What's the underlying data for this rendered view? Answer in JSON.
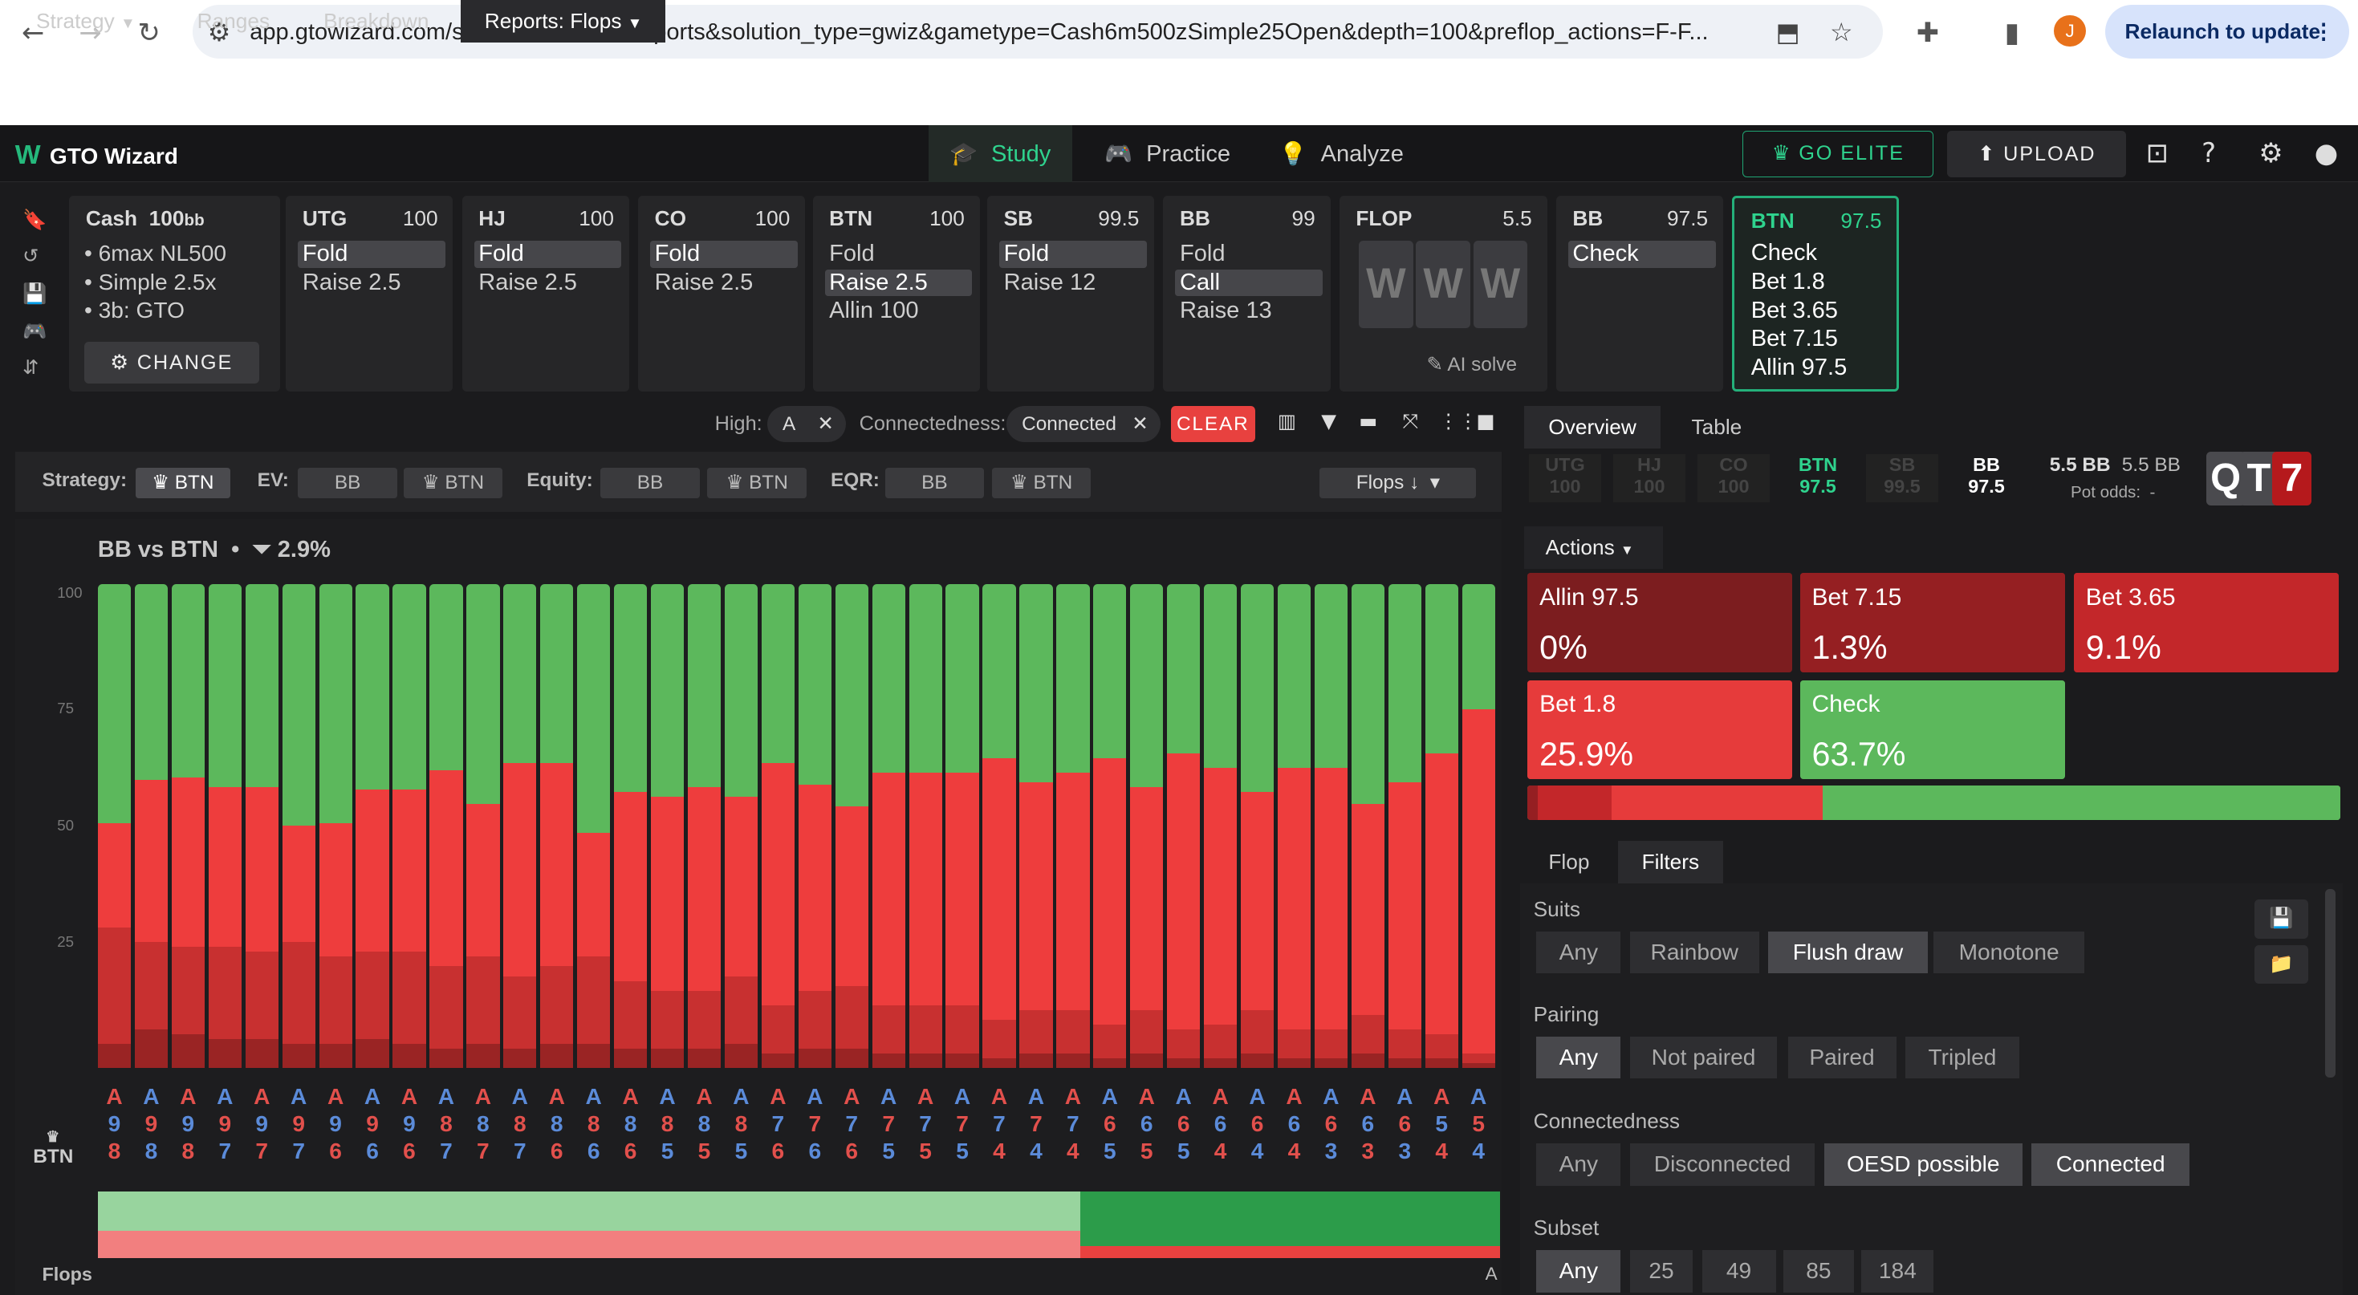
{
  "browser": {
    "url": "app.gtowizard.com/solutions?soltab=reports&solution_type=gwiz&gametype=Cash6m500zSimple25Open&depth=100&preflop_actions=F-F...",
    "relaunch": "Relaunch to update",
    "avatar": "J"
  },
  "app": {
    "logo": "GTO Wizard",
    "nav": [
      "Study",
      "Practice",
      "Analyze"
    ],
    "go_elite": "GO ELITE",
    "upload": "UPLOAD"
  },
  "game": {
    "title": "Cash",
    "stack": "100",
    "stack_unit": "bb",
    "bullets": [
      "6max NL500",
      "Simple 2.5x",
      "3b: GTO"
    ],
    "change": "CHANGE"
  },
  "positions": [
    {
      "name": "UTG",
      "stack": "100",
      "actions": [
        "Fold",
        "Raise 2.5"
      ],
      "sel": 0
    },
    {
      "name": "HJ",
      "stack": "100",
      "actions": [
        "Fold",
        "Raise 2.5"
      ],
      "sel": 0
    },
    {
      "name": "CO",
      "stack": "100",
      "actions": [
        "Fold",
        "Raise 2.5"
      ],
      "sel": 0
    },
    {
      "name": "BTN",
      "stack": "100",
      "actions": [
        "Fold",
        "Raise 2.5",
        "Allin 100"
      ],
      "sel": 1
    },
    {
      "name": "SB",
      "stack": "99.5",
      "actions": [
        "Fold",
        "Raise 12"
      ],
      "sel": 0
    },
    {
      "name": "BB",
      "stack": "99",
      "actions": [
        "Fold",
        "Call",
        "Raise 13"
      ],
      "sel": 1
    }
  ],
  "flop": {
    "label": "FLOP",
    "pot": "5.5",
    "cards": [
      "W",
      "W",
      "W"
    ],
    "ai": "AI solve"
  },
  "bb_card": {
    "name": "BB",
    "stack": "97.5",
    "actions": [
      "Check"
    ]
  },
  "btn_card": {
    "name": "BTN",
    "stack": "97.5",
    "actions": [
      "Check",
      "Bet 1.8",
      "Bet 3.65",
      "Bet 7.15",
      "Allin 97.5"
    ]
  },
  "tabs": {
    "strategy": "Strategy",
    "ranges": "Ranges",
    "breakdown": "Breakdown",
    "reports": "Reports: Flops"
  },
  "filters": {
    "high_label": "High:",
    "high_val": "A",
    "conn_label": "Connectedness:",
    "conn_val": "Connected",
    "clear": "CLEAR"
  },
  "stratbar": {
    "strategy": "Strategy:",
    "ev": "EV:",
    "equity": "Equity:",
    "eqr": "EQR:",
    "bb": "BB",
    "btn": "BTN",
    "flops": "Flops"
  },
  "chart_data": {
    "type": "bar",
    "title": "BB vs BTN",
    "filter_pct": "2.9%",
    "yticks": [
      "100",
      "75",
      "50",
      "25"
    ],
    "ylim": [
      0,
      100
    ],
    "player": "BTN",
    "xlabel": "Flops",
    "xend": "A",
    "categories": [
      "A98",
      "A98",
      "A98",
      "A97",
      "A97",
      "A97",
      "A96",
      "A96",
      "A96",
      "A87",
      "A87",
      "A87",
      "A86",
      "A86",
      "A86",
      "A85",
      "A85",
      "A85",
      "A76",
      "A76",
      "A76",
      "A75",
      "A75",
      "A75",
      "A74",
      "A74",
      "A74",
      "A65",
      "A65",
      "A65",
      "A64",
      "A64",
      "A64",
      "A63",
      "A63",
      "A63",
      "A54",
      "A54"
    ],
    "series_names": [
      "Allin 97.5",
      "Bet 7.15",
      "Bet 3.65",
      "Bet 1.8",
      "Check"
    ],
    "colors": [
      "#7a1c1c",
      "#9a2424",
      "#c83030",
      "#ee3d3d",
      "#5cb85c"
    ],
    "check": [
      49.5,
      40.5,
      40,
      42,
      42,
      50,
      49.5,
      42.5,
      42.5,
      38.5,
      45.5,
      37,
      37,
      51.5,
      43,
      44,
      42,
      44,
      37,
      41.5,
      46,
      39,
      39,
      39,
      36,
      41,
      39,
      36,
      42,
      35,
      38,
      43,
      38,
      38,
      45.5,
      41,
      35,
      26
    ],
    "allin": [
      [
        0,
        1
      ],
      [
        0,
        1
      ],
      [
        0,
        1
      ],
      [
        0,
        1
      ],
      [
        0,
        1
      ],
      [
        0,
        1
      ],
      [
        0,
        1
      ],
      [
        0,
        1
      ],
      [
        0,
        1
      ],
      [
        0,
        1
      ],
      [
        0,
        1
      ],
      [
        0,
        1
      ],
      [
        0,
        1
      ],
      [
        0,
        1
      ],
      [
        0,
        1
      ],
      [
        0,
        1
      ],
      [
        0,
        1
      ],
      [
        0,
        1
      ],
      [
        0,
        1
      ],
      [
        0,
        1
      ],
      [
        0,
        1
      ],
      [
        0,
        1
      ],
      [
        0,
        1
      ],
      [
        0,
        1
      ],
      [
        0,
        1
      ],
      [
        0,
        1
      ],
      [
        0,
        1
      ],
      [
        0,
        1
      ],
      [
        0,
        1
      ],
      [
        0,
        1
      ],
      [
        0,
        1
      ],
      [
        0,
        1
      ],
      [
        0,
        1
      ],
      [
        0,
        1
      ],
      [
        0,
        1
      ],
      [
        0,
        1
      ],
      [
        0,
        1
      ],
      [
        0,
        1
      ]
    ],
    "bet715": [
      5,
      8,
      7,
      6,
      6,
      5,
      5,
      6,
      5,
      4,
      5,
      4,
      5,
      5,
      4,
      4,
      4,
      5,
      3,
      4,
      4,
      3,
      3,
      3,
      2,
      3,
      3,
      2,
      3,
      2,
      2,
      3,
      2,
      2,
      3,
      2,
      2,
      1
    ],
    "bet365": [
      24,
      18,
      18,
      19,
      18,
      21,
      18,
      18,
      19,
      17,
      18,
      15,
      16,
      18,
      14,
      12,
      12,
      14,
      10,
      12,
      13,
      10,
      10,
      10,
      8,
      9,
      9,
      7,
      9,
      6,
      7,
      9,
      6,
      6,
      8,
      6,
      5,
      2
    ],
    "suit_colors": {
      "red": "#e2504c",
      "blue": "#5b8bd9"
    }
  },
  "right": {
    "overview": "Overview",
    "table": "Table",
    "pos": [
      {
        "n": "UTG",
        "v": "100"
      },
      {
        "n": "HJ",
        "v": "100"
      },
      {
        "n": "CO",
        "v": "100"
      },
      {
        "n": "BTN",
        "v": "97.5"
      },
      {
        "n": "SB",
        "v": "99.5"
      },
      {
        "n": "BB",
        "v": "97.5"
      }
    ],
    "pot1": "5.5 BB",
    "pot2": "5.5 BB",
    "pot_odds": "Pot odds:",
    "pot_odds_val": "-",
    "board": [
      "Q",
      "T",
      "7"
    ],
    "actions_label": "Actions",
    "actions": [
      {
        "n": "Allin 97.5",
        "p": "0%",
        "c": "#7c1d1f"
      },
      {
        "n": "Bet 7.15",
        "p": "1.3%",
        "c": "#951f22"
      },
      {
        "n": "Bet 3.65",
        "p": "9.1%",
        "c": "#c3272a"
      },
      {
        "n": "Bet 1.8",
        "p": "25.9%",
        "c": "#e63b3b"
      },
      {
        "n": "Check",
        "p": "63.7%",
        "c": "#5cb85c"
      }
    ],
    "bar": [
      0,
      1.3,
      9.1,
      25.9,
      63.7
    ],
    "ftabs": [
      "Flop",
      "Filters"
    ],
    "suits": {
      "label": "Suits",
      "opts": [
        "Any",
        "Rainbow",
        "Flush draw",
        "Monotone"
      ],
      "sel": 2
    },
    "pairing": {
      "label": "Pairing",
      "opts": [
        "Any",
        "Not paired",
        "Paired",
        "Tripled"
      ],
      "sel": 0
    },
    "connect": {
      "label": "Connectedness",
      "opts": [
        "Any",
        "Disconnected",
        "OESD possible",
        "Connected"
      ],
      "sel": [
        2,
        3
      ]
    },
    "subset": {
      "label": "Subset",
      "opts": [
        "Any",
        "25",
        "49",
        "85",
        "184"
      ],
      "sel": 0
    }
  }
}
